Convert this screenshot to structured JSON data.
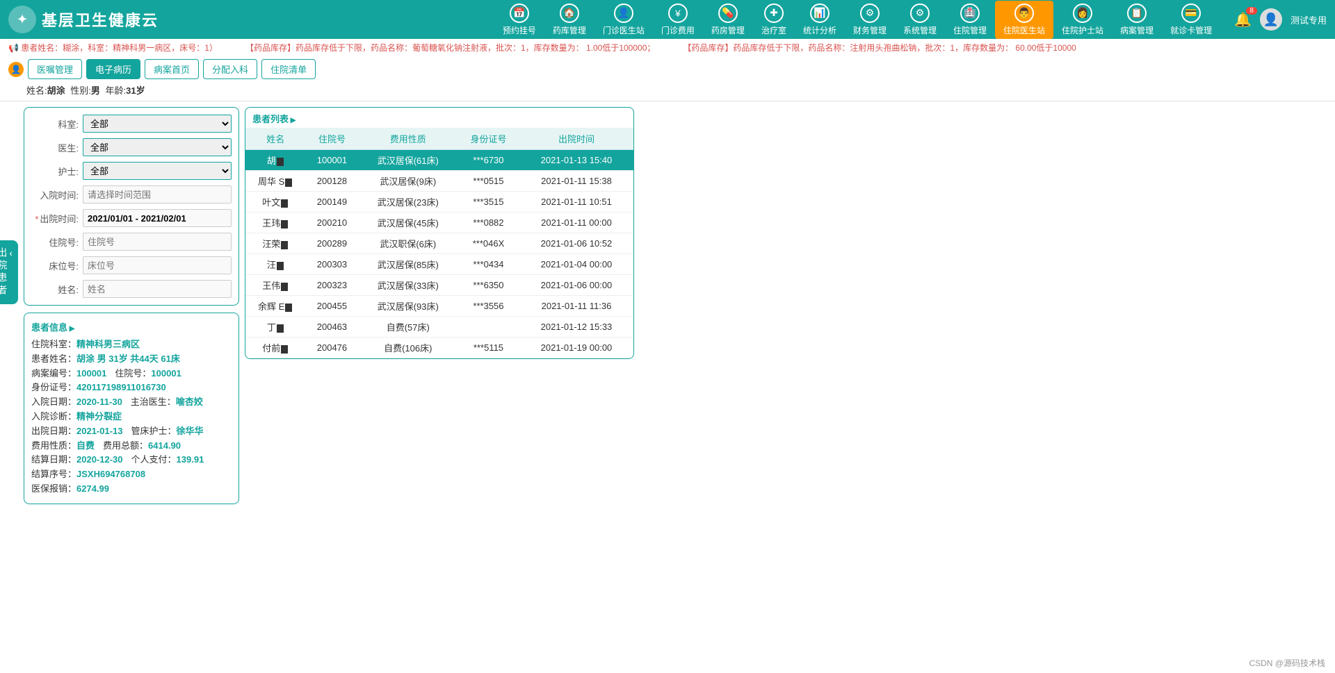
{
  "header": {
    "title": "基层卫生健康云",
    "nav": [
      {
        "label": "预约挂号",
        "icon": "📅"
      },
      {
        "label": "药库管理",
        "icon": "🏠"
      },
      {
        "label": "门诊医生站",
        "icon": "👤"
      },
      {
        "label": "门诊费用",
        "icon": "¥"
      },
      {
        "label": "药房管理",
        "icon": "💊"
      },
      {
        "label": "治疗室",
        "icon": "✚"
      },
      {
        "label": "统计分析",
        "icon": "📊"
      },
      {
        "label": "财务管理",
        "icon": "⚙"
      },
      {
        "label": "系统管理",
        "icon": "⚙"
      },
      {
        "label": "住院管理",
        "icon": "🏥"
      },
      {
        "label": "住院医生站",
        "icon": "👨",
        "active": true
      },
      {
        "label": "住院护士站",
        "icon": "👩"
      },
      {
        "label": "病案管理",
        "icon": "📋"
      },
      {
        "label": "就诊卡管理",
        "icon": "💳"
      }
    ],
    "badge": "8",
    "username": "测试专用"
  },
  "alert": {
    "seg1": "患者姓名：糊涂，科室：精神科男一病区，床号：1）",
    "seg2": "【药品库存】药品库存低于下限，药品名称：葡萄糖氧化钠注射液，批次：1，库存数量为： 1.00低于100000；",
    "seg3": "【药品库存】药品库存低于下限，药品名称：注射用头孢曲松钠，批次：1，库存数量为： 60.00低于10000"
  },
  "tabs": [
    "医嘱管理",
    "电子病历",
    "病案首页",
    "分配入科",
    "住院清单"
  ],
  "activeTab": "电子病历",
  "infoLine": {
    "name_lbl": "姓名:",
    "name": "胡涂",
    "sex_lbl": "性别:",
    "sex": "男",
    "age_lbl": "年龄:",
    "age": "31岁"
  },
  "sideTab": "出院患者",
  "filter": {
    "dept_lbl": "科室:",
    "dept": "全部",
    "doctor_lbl": "医生:",
    "doctor": "全部",
    "nurse_lbl": "护士:",
    "nurse": "全部",
    "admit_lbl": "入院时间:",
    "admit_ph": "请选择时间范围",
    "discharge_lbl": "出院时间:",
    "discharge": "2021/01/01 - 2021/02/01",
    "hosp_lbl": "住院号:",
    "hosp_ph": "住院号",
    "bed_lbl": "床位号:",
    "bed_ph": "床位号",
    "name_lbl": "姓名:",
    "name_ph": "姓名"
  },
  "pinfo": {
    "title": "患者信息",
    "dept_lbl": "住院科室：",
    "dept": "精神科男三病区",
    "name_lbl": "患者姓名：",
    "name": "胡涂 男 31岁 共44天 61床",
    "case_lbl": "病案编号：",
    "case": "100001",
    "hosp_lbl2": "住院号：",
    "hosp": "100001",
    "id_lbl": "身份证号：",
    "id": "420117198911016730",
    "admit_lbl": "入院日期：",
    "admit": "2020-11-30",
    "doctor_lbl2": "主治医生：",
    "doctor": "喻杏姣",
    "diag_lbl": "入院诊断：",
    "diag": "精神分裂症",
    "disc_lbl": "出院日期：",
    "disc": "2021-01-13",
    "nurse_lbl2": "管床护士：",
    "nurse": "徐华华",
    "feetype_lbl": "费用性质：",
    "feetype": "自费",
    "total_lbl": "费用总额：",
    "total": "6414.90",
    "settle_lbl": "结算日期：",
    "settle": "2020-12-30",
    "selfpay_lbl": "个人支付：",
    "selfpay": "139.91",
    "seq_lbl": "结算序号：",
    "seq": "JSXH694768708",
    "ins_lbl": "医保报销：",
    "ins": "6274.99"
  },
  "table": {
    "title": "患者列表",
    "headers": [
      "姓名",
      "住院号",
      "费用性质",
      "身份证号",
      "出院时间"
    ],
    "rows": [
      {
        "name": "胡",
        "hosp": "100001",
        "fee": "武汉居保(61床)",
        "id": "***6730",
        "time": "2021-01-13 15:40",
        "sel": true
      },
      {
        "name": "周华  S",
        "hosp": "200128",
        "fee": "武汉居保(9床)",
        "id": "***0515",
        "time": "2021-01-11 15:38"
      },
      {
        "name": "叶文",
        "hosp": "200149",
        "fee": "武汉居保(23床)",
        "id": "***3515",
        "time": "2021-01-11 10:51"
      },
      {
        "name": "王玮",
        "hosp": "200210",
        "fee": "武汉居保(45床)",
        "id": "***0882",
        "time": "2021-01-11 00:00"
      },
      {
        "name": "汪荣",
        "hosp": "200289",
        "fee": "武汉职保(6床)",
        "id": "***046X",
        "time": "2021-01-06 10:52"
      },
      {
        "name": "汪",
        "hosp": "200303",
        "fee": "武汉居保(85床)",
        "id": "***0434",
        "time": "2021-01-04 00:00"
      },
      {
        "name": "王伟",
        "hosp": "200323",
        "fee": "武汉居保(33床)",
        "id": "***6350",
        "time": "2021-01-06 00:00"
      },
      {
        "name": "余辉  E",
        "hosp": "200455",
        "fee": "武汉居保(93床)",
        "id": "***3556",
        "time": "2021-01-11 11:36"
      },
      {
        "name": "丁",
        "hosp": "200463",
        "fee": "自费(57床)",
        "id": "",
        "time": "2021-01-12 15:33"
      },
      {
        "name": "付前",
        "hosp": "200476",
        "fee": "自费(106床)",
        "id": "***5115",
        "time": "2021-01-19 00:00"
      }
    ]
  },
  "watermark": "CSDN @源码技术栈"
}
